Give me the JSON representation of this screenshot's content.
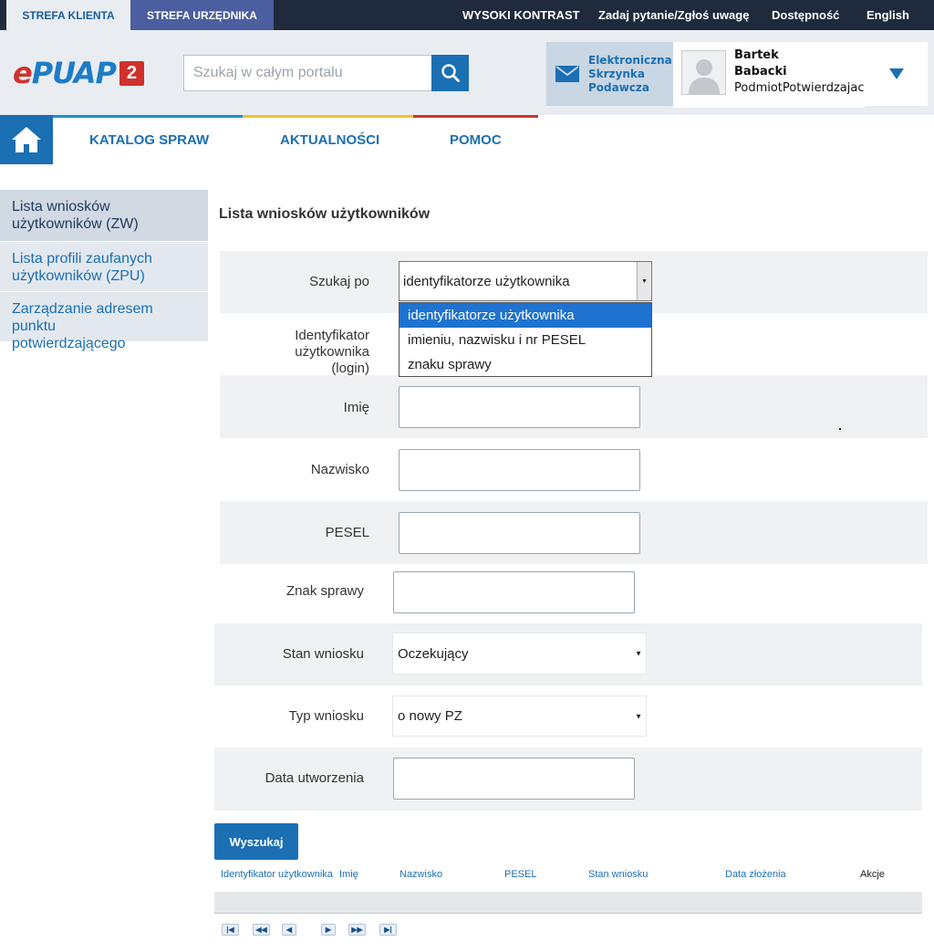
{
  "topbar": {
    "tab_client": "STREFA KLIENTA",
    "tab_official": "STREFA URZĘDNIKA",
    "high_contrast": "WYSOKI KONTRAST",
    "ask_question": "Zadaj pytanie/Zgłoś uwagę",
    "accessibility": "Dostępność",
    "language": "English"
  },
  "header": {
    "logo_prefix": "e",
    "logo_main": "PUAP",
    "logo_badge": "2",
    "search_placeholder": "Szukaj w całym portalu",
    "mailbox_line1": "Elektroniczna",
    "mailbox_line2": "Skrzynka",
    "mailbox_line3": "Podawcza",
    "user_first_name": "Bartek",
    "user_last_name": "Babacki",
    "user_role": "PodmiotPotwierdzajacy",
    "icons": {
      "search": "search-icon",
      "mail": "envelope-icon",
      "avatar": "user-avatar-icon",
      "toggle": "triangle-down-icon"
    }
  },
  "nav": {
    "items": [
      "KATALOG SPRAW",
      "AKTUALNOŚCI",
      "POMOC"
    ],
    "stripe_colors": [
      "#1b8fd0",
      "#f1c232",
      "#d0312d"
    ]
  },
  "sidebar": {
    "items": [
      {
        "line1": "Lista wniosków",
        "line2": "użytkowników (ZW)",
        "active": true
      },
      {
        "line1": "Lista profili zaufanych",
        "line2": "użytkowników (ZPU)",
        "active": false
      },
      {
        "line1": "Zarządzanie adresem punktu",
        "line2": "potwierdzającego",
        "active": false
      }
    ]
  },
  "main": {
    "heading": "Lista wniosków użytkowników",
    "search_by_label": "Szukaj po",
    "search_by_value": "identyfikatorze użytkownika",
    "search_by_options": [
      "identyfikatorze użytkownika",
      "imieniu, nazwisku i nr PESEL",
      "znaku sprawy"
    ],
    "user_id_label_line1": "Identyfikator użytkownika",
    "user_id_label_line2": "(login)",
    "first_name_label": "Imię",
    "last_name_label": "Nazwisko",
    "pesel_label": "PESEL",
    "case_number_label": "Znak sprawy",
    "status_label": "Stan wniosku",
    "status_value": "Oczekujący",
    "type_label": "Typ wniosku",
    "type_value": "o nowy PZ",
    "created_label": "Data utworzenia",
    "search_button": "Wyszukaj"
  },
  "table": {
    "headers": [
      "Identyfikator użytkownika",
      "Imię",
      "Nazwisko",
      "PESEL",
      "Stan wniosku",
      "Data złożenia",
      "Akcje"
    ]
  },
  "pagination": {
    "first": "|◀",
    "prev_fast": "◀◀",
    "prev": "◀",
    "next": "▶",
    "next_fast": "▶▶",
    "last": "▶|"
  },
  "colors": {
    "accent": "#1b6fb3",
    "topbar_bg": "#1f2a3c",
    "header_bg": "#e9edf2",
    "dropdown_selected": "#1e72d0",
    "logo_red": "#d0312d"
  }
}
